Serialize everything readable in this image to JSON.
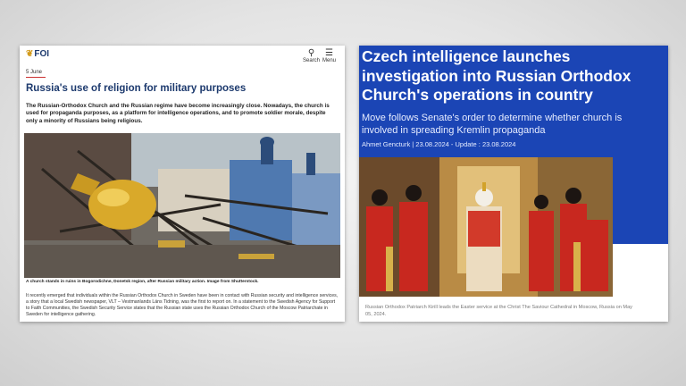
{
  "left_article": {
    "logo": "FOI",
    "search_label": "Search",
    "menu_label": "Menu",
    "date": "5 June",
    "title": "Russia's use of religion for military purposes",
    "lead": "The Russian-Orthodox Church and the Russian regime have become increasingly close. Nowadays, the church is used for propaganda purposes, as a platform for intelligence operations, and to promote soldier morale, despite only a minority of Russians being religious.",
    "caption": "A church stands in ruins in Bogorodichne, Donetsk region, after Russian military action. Image from Shutterstock.",
    "body": "It recently emerged that individuals within the Russian Orthodox Church in Sweden have been in contact with Russian security and intelligence services, a story that a local Swedish newspaper, VLT – Vestmanlands Läns Tidning, was the first to report on. In a statement to the Swedish Agency for Support to Faith Communities, the Swedish Security Service states that the Russian state uses the Russian Orthodox Church of the Moscow Patriarchate in Sweden for intelligence gathering."
  },
  "right_article": {
    "title": "Czech intelligence launches investigation into Russian Orthodox Church's operations in country",
    "subtitle": "Move follows Senate's order to determine whether church is involved in spreading Kremlin propaganda",
    "byline": "Ahmet Gencturk  |   23.08.2024 - Update : 23.08.2024",
    "caption": "Russian Orthodox Patriarch Kirill leads the Easter service at the Christ The Saviour Cathedral in Moscow, Russia on May 05, 2024."
  },
  "icons": {
    "search": "search-icon",
    "menu": "hamburger-menu-icon"
  },
  "colors": {
    "foi_navy": "#1d3a6e",
    "aa_blue": "#1b45b5"
  }
}
